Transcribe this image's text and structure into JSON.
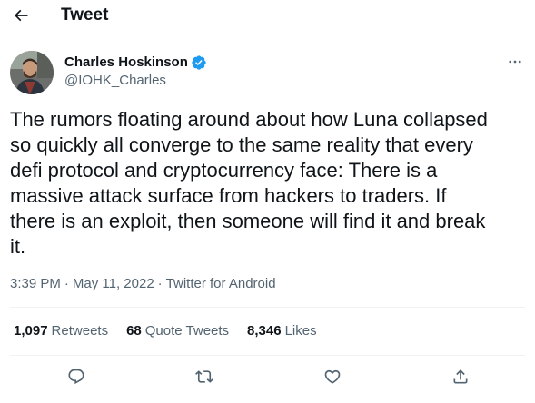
{
  "header": {
    "title": "Tweet",
    "back_icon": "arrow-left-icon"
  },
  "tweet": {
    "author": {
      "name": "Charles Hoskinson",
      "handle": "@IOHK_Charles",
      "verified": true,
      "avatar_icon": "avatar"
    },
    "text": "The rumors floating around about how Luna collapsed\nso quickly all converge to the same reality that every\ndefi protocol and cryptocurrency face: There is a\nmassive attack surface from hackers to traders. If\nthere is an exploit, then someone will find it and break\nit.",
    "time": "3:39 PM",
    "separator": "·",
    "date": "May 11, 2022",
    "source": "Twitter for Android"
  },
  "stats": {
    "retweets_count": "1,097",
    "retweets_label": "Retweets",
    "quote_count": "68",
    "quote_label": "Quote Tweets",
    "likes_count": "8,346",
    "likes_label": "Likes"
  },
  "actions": {
    "reply_icon": "reply-icon",
    "retweet_icon": "retweet-icon",
    "like_icon": "heart-icon",
    "share_icon": "share-icon"
  },
  "colors": {
    "text": "#0f1419",
    "secondary": "#536471",
    "verified": "#1d9bf0",
    "divider": "#eff3f4"
  }
}
